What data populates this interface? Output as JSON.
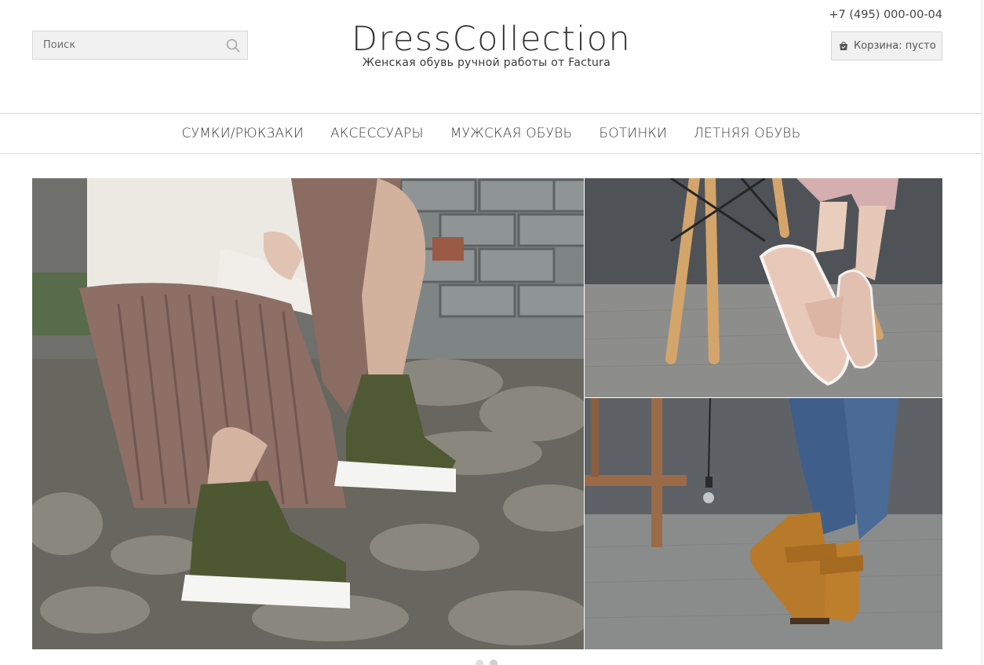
{
  "search": {
    "placeholder": "Поиск",
    "icon": "search-icon"
  },
  "logo": {
    "title": "DressCollection",
    "tagline": "Женская обувь ручной работы от Factura"
  },
  "contact": {
    "phone": "+7 (495) 000-00-04"
  },
  "cart": {
    "label": "Корзина: пусто",
    "icon": "cart-icon"
  },
  "nav": {
    "items": [
      {
        "label": "СУМКИ/РЮКЗАКИ"
      },
      {
        "label": "АКСЕССУАРЫ"
      },
      {
        "label": "МУЖСКАЯ ОБУВЬ"
      },
      {
        "label": "БОТИНКИ"
      },
      {
        "label": "ЛЕТНЯЯ ОБУВЬ"
      }
    ]
  },
  "banners": [
    {
      "subject": "olive-lace-up-boots-on-stone-steps"
    },
    {
      "subject": "nude-tassel-loafers"
    },
    {
      "subject": "mustard-buckle-ankle-boots"
    }
  ],
  "slider": {
    "slides": 2,
    "active": 1
  },
  "colors": {
    "accent_gray": "#f1f1f1",
    "border": "#d6d6d6",
    "text": "#333333"
  }
}
